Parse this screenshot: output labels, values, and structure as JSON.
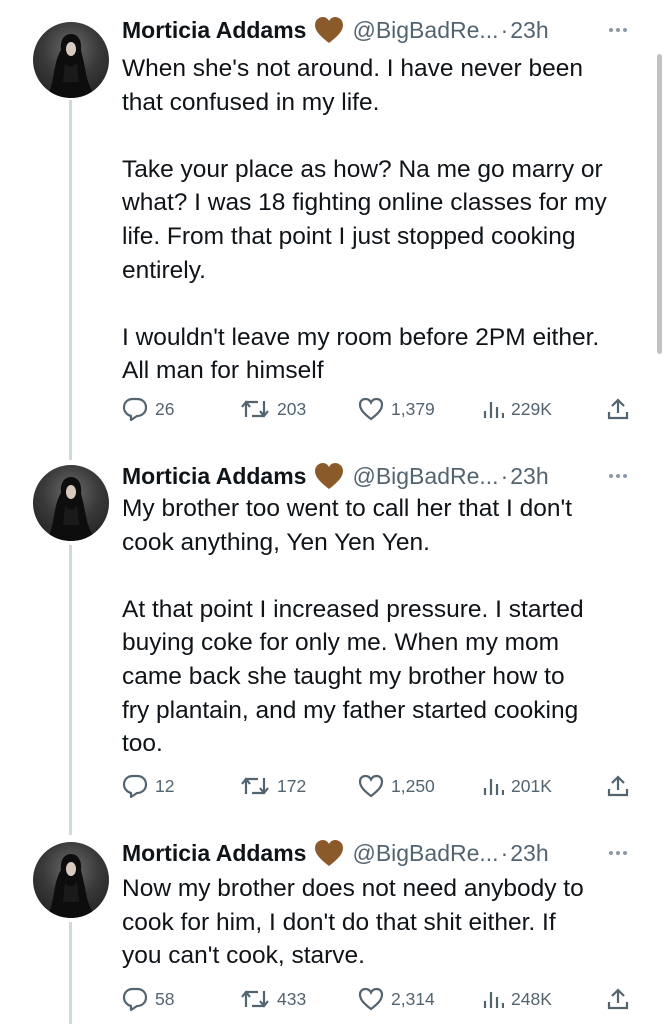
{
  "tweets": [
    {
      "name": "Morticia Addams",
      "handle": "@BigBadRe...",
      "time": "23h",
      "text": "When she's not around. I have never been\nthat confused in my life.\n\nTake your place as how? Na me go marry or\nwhat? I was 18 fighting online classes for my\nlife. From that point I just stopped cooking\nentirely.\n\nI wouldn't leave my room before 2PM either.\nAll man for himself",
      "replies": "26",
      "retweets": "203",
      "likes": "1,379",
      "views": "229K"
    },
    {
      "name": "Morticia Addams",
      "handle": "@BigBadRe...",
      "time": "23h",
      "text": "My brother too went to call her that I don't\ncook anything, Yen Yen Yen.\n\nAt that point I increased pressure. I started\nbuying coke for only me. When my mom\ncame back she taught my brother how to\nfry plantain, and my father started cooking\ntoo.",
      "replies": "12",
      "retweets": "172",
      "likes": "1,250",
      "views": "201K"
    },
    {
      "name": "Morticia Addams",
      "handle": "@BigBadRe...",
      "time": "23h",
      "text": "Now my brother does not need anybody to\ncook for him, I don't do that shit either. If\nyou can't cook, starve.",
      "replies": "58",
      "retweets": "433",
      "likes": "2,314",
      "views": "248K"
    }
  ],
  "icons": {
    "badge": "brown-heart-icon",
    "reply": "reply-icon",
    "retweet": "retweet-icon",
    "like": "like-icon",
    "views": "views-icon",
    "share": "share-icon",
    "more": "more-icon"
  },
  "colors": {
    "text": "#0f1419",
    "secondary": "#536471",
    "thread_line": "#cfd9de",
    "heart_brown": "#8b5a2b"
  }
}
